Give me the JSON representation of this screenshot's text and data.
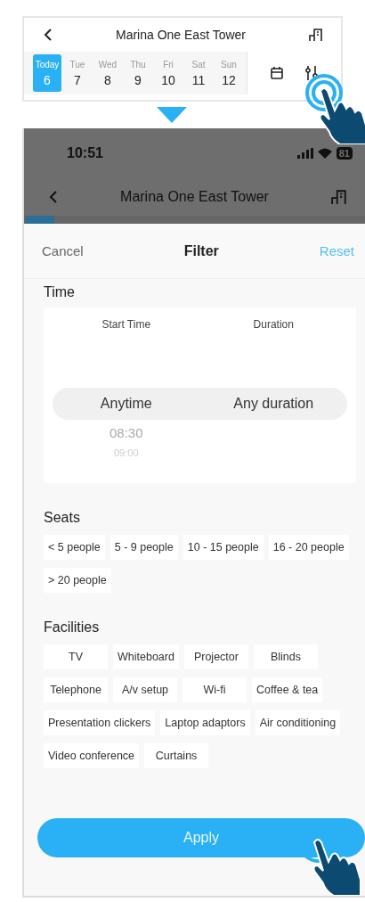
{
  "preview": {
    "title": "Marina One East Tower",
    "days": [
      {
        "weekday": "Today",
        "date": "6",
        "selected": true
      },
      {
        "weekday": "Tue",
        "date": "7",
        "selected": false
      },
      {
        "weekday": "Wed",
        "date": "8",
        "selected": false
      },
      {
        "weekday": "Thu",
        "date": "9",
        "selected": false
      },
      {
        "weekday": "Fri",
        "date": "10",
        "selected": false
      },
      {
        "weekday": "Sat",
        "date": "11",
        "selected": false
      },
      {
        "weekday": "Sun",
        "date": "12",
        "selected": false
      }
    ]
  },
  "status_bar": {
    "time": "10:51",
    "battery": "81"
  },
  "header": {
    "title": "Marina One East Tower"
  },
  "sheet": {
    "cancel": "Cancel",
    "title": "Filter",
    "reset": "Reset"
  },
  "time": {
    "label": "Time",
    "columns": [
      "Start Time",
      "Duration"
    ],
    "selected": [
      "Anytime",
      "Any duration"
    ],
    "next": "08:30",
    "after": "09:00"
  },
  "seats": {
    "label": "Seats",
    "options": [
      {
        "label": "< 5 people",
        "selected": false
      },
      {
        "label": "5 - 9 people",
        "selected": false
      },
      {
        "label": "10 - 15 people",
        "selected": false
      },
      {
        "label": "16 - 20 people",
        "selected": false
      },
      {
        "label": "> 20 people",
        "selected": false
      }
    ]
  },
  "facilities": {
    "label": "Facilities",
    "options": [
      {
        "label": "TV",
        "selected": false
      },
      {
        "label": "Whiteboard",
        "selected": false
      },
      {
        "label": "Projector",
        "selected": false
      },
      {
        "label": "Blinds",
        "selected": false
      },
      {
        "label": "Telephone",
        "selected": false
      },
      {
        "label": "A/v setup",
        "selected": false
      },
      {
        "label": "Wi-fi",
        "selected": false
      },
      {
        "label": "Coffee & tea",
        "selected": false
      },
      {
        "label": "Presentation clickers",
        "selected": false
      },
      {
        "label": "Laptop adaptors",
        "selected": false
      },
      {
        "label": "Air conditioning",
        "selected": false
      },
      {
        "label": "Video conference",
        "selected": false
      },
      {
        "label": "Curtains",
        "selected": false
      }
    ]
  },
  "apply": "Apply"
}
